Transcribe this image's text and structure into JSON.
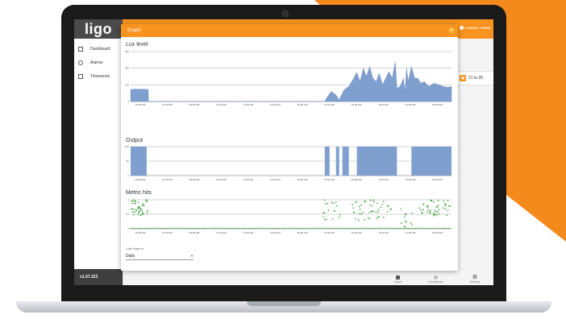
{
  "colors": {
    "brand_orange": "#f7931e",
    "area_fill": "#7f9fcf",
    "scatter_green": "#2e9b2e",
    "sidebar_dark": "#3f3f3f"
  },
  "app": {
    "logo": "ligo",
    "version": "v1.07.223",
    "logout_label": "LOGOUT LIPPIN"
  },
  "sidebar": {
    "items": [
      {
        "label": "Dashboard",
        "icon": "grid-icon"
      },
      {
        "label": "Alarms",
        "icon": "alarm-clock-icon"
      },
      {
        "label": "Timezones",
        "icon": "calendar-icon"
      }
    ]
  },
  "range_chip": {
    "label": "21 to 25",
    "icon": "calendar-icon"
  },
  "bottom_nav": [
    {
      "label": "Graph",
      "icon": "bar-chart-icon"
    },
    {
      "label": "Emergency",
      "icon": "emergency-icon"
    },
    {
      "label": "Settings",
      "icon": "gear-icon"
    }
  ],
  "dialog": {
    "title": "Graph",
    "close_icon": "close-icon",
    "limit_label": "Limit Graph to",
    "limit_value": "Daily"
  },
  "time_ticks": [
    "05:00 PM",
    "07:00 PM",
    "09:00 PM",
    "11:00 PM",
    "01:00 AM",
    "03:00 AM",
    "05:00 AM",
    "07:00 AM",
    "09:00 AM",
    "11:00 AM",
    "01:00 PM",
    "03:00 PM"
  ],
  "chart_data": [
    {
      "type": "area",
      "title": "Lux level",
      "ylim": [
        0,
        300
      ],
      "yticks": [
        "0",
        "100",
        "200",
        "300"
      ],
      "x_ticks_ref": "time_ticks",
      "grid": true,
      "points": [
        [
          0,
          72
        ],
        [
          0.3,
          75
        ],
        [
          0.6,
          73
        ],
        [
          0.9,
          74
        ],
        [
          1.1,
          72
        ],
        [
          1.11,
          0
        ],
        [
          12.1,
          0
        ],
        [
          12.2,
          20
        ],
        [
          12.5,
          60
        ],
        [
          12.8,
          40
        ],
        [
          13,
          10
        ],
        [
          13.3,
          70
        ],
        [
          13.6,
          90
        ],
        [
          13.9,
          140
        ],
        [
          14.1,
          175
        ],
        [
          14.3,
          120
        ],
        [
          14.5,
          200
        ],
        [
          14.7,
          150
        ],
        [
          14.9,
          210
        ],
        [
          15.1,
          140
        ],
        [
          15.3,
          120
        ],
        [
          15.5,
          170
        ],
        [
          15.7,
          100
        ],
        [
          15.9,
          140
        ],
        [
          16.1,
          180
        ],
        [
          16.3,
          140
        ],
        [
          16.5,
          240
        ],
        [
          16.6,
          80
        ],
        [
          16.8,
          90
        ],
        [
          17.0,
          140
        ],
        [
          17.1,
          60
        ],
        [
          17.2,
          200
        ],
        [
          17.3,
          120
        ],
        [
          17.5,
          210
        ],
        [
          17.7,
          140
        ],
        [
          17.9,
          140
        ],
        [
          18.1,
          110
        ],
        [
          18.3,
          120
        ],
        [
          18.6,
          90
        ],
        [
          18.9,
          110
        ],
        [
          19.2,
          100
        ],
        [
          19.5,
          90
        ],
        [
          19.8,
          85
        ],
        [
          20,
          90
        ]
      ]
    },
    {
      "type": "area",
      "title": "Output",
      "ylim": [
        0,
        100
      ],
      "yticks": [
        "0",
        "50",
        "100"
      ],
      "x_ticks_ref": "time_ticks",
      "grid": true,
      "segments": [
        [
          0,
          1.0
        ],
        [
          12.1,
          12.4
        ],
        [
          12.8,
          13.0
        ],
        [
          13.2,
          13.6
        ],
        [
          14.1,
          16.6
        ],
        [
          17.5,
          20
        ]
      ]
    },
    {
      "type": "scatter",
      "title": "Metric hits",
      "ylim": [
        0,
        1
      ],
      "yticks": [
        "0",
        "0.5",
        "1"
      ],
      "x_ticks_ref": "time_ticks",
      "grid": true,
      "clusters": [
        {
          "x_from": 0,
          "x_to": 1.1,
          "y_from": 0.45,
          "y_to": 1.0,
          "count": 45
        },
        {
          "x_from": 12.0,
          "x_to": 13.2,
          "y_from": 0.3,
          "y_to": 1.0,
          "count": 18
        },
        {
          "x_from": 13.8,
          "x_to": 16.3,
          "y_from": 0.3,
          "y_to": 1.0,
          "count": 45
        },
        {
          "x_from": 16.8,
          "x_to": 17.6,
          "y_from": 0.05,
          "y_to": 0.9,
          "count": 12
        },
        {
          "x_from": 18.0,
          "x_to": 20.0,
          "y_from": 0.45,
          "y_to": 1.0,
          "count": 45
        }
      ],
      "baseline": {
        "x_from": 0,
        "x_to": 20,
        "y": 0
      }
    }
  ]
}
